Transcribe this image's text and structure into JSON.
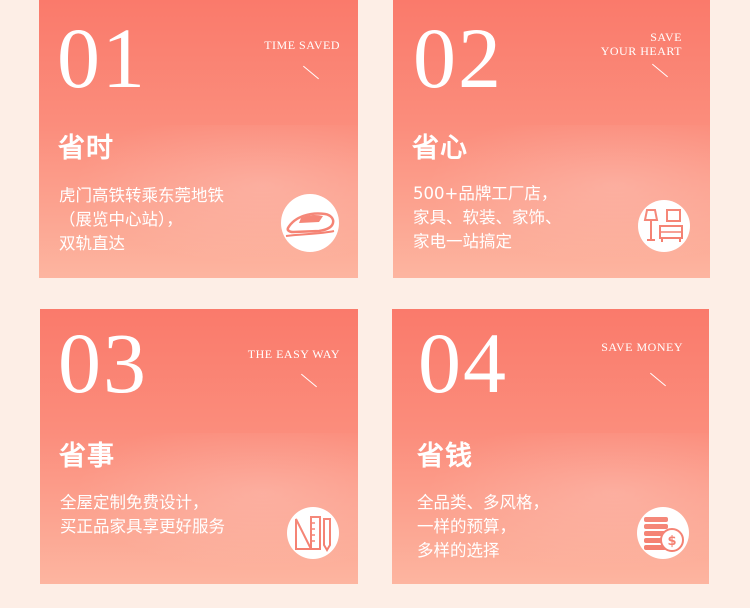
{
  "cards": [
    {
      "number": "01",
      "tag": [
        "TIME SAVED"
      ],
      "title": "省时",
      "lines": [
        "虎门高铁转乘东莞地铁",
        "（展览中心站），",
        "双轨直达"
      ],
      "icon": "high-speed-train-icon"
    },
    {
      "number": "02",
      "tag": [
        "SAVE",
        "YOUR HEART"
      ],
      "title": "省心",
      "lines": [
        "500+品牌工厂店，",
        "家具、软装、家饰、",
        "家电一站搞定"
      ],
      "icon": "furniture-lamp-icon"
    },
    {
      "number": "03",
      "tag": [
        "THE EASY WAY"
      ],
      "title": "省事",
      "lines": [
        "全屋定制免费设计，",
        "买正品家具享更好服务"
      ],
      "icon": "design-tools-icon"
    },
    {
      "number": "04",
      "tag": [
        "SAVE MONEY"
      ],
      "title": "省钱",
      "lines": [
        "全品类、多风格，",
        "一样的预算，",
        "多样的选择"
      ],
      "icon": "coins-money-icon"
    }
  ],
  "colors": {
    "card_top": "#fa7a6b",
    "card_bottom": "#fdb5a0",
    "icon_stroke": "#f47a6a",
    "background": "#fdeee6"
  }
}
